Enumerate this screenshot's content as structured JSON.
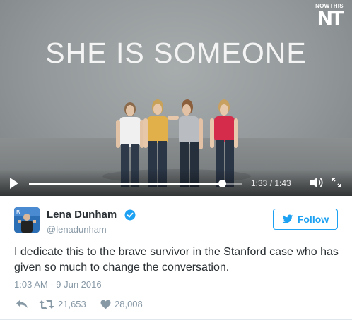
{
  "video": {
    "headline": "SHE IS SOMEONE",
    "brand": {
      "name": "NOWTHIS",
      "logo": "NT"
    },
    "player": {
      "current_time": "1:33",
      "duration": "1:43",
      "time_display": "1:33 / 1:43",
      "progress": 0.9029,
      "icons": [
        "play-icon",
        "volume-icon",
        "fullscreen-icon"
      ]
    }
  },
  "tweet": {
    "author": {
      "name": "Lena Dunham",
      "handle": "@lenadunham",
      "verified": true
    },
    "follow_label": "Follow",
    "text": "I dedicate this to the brave survivor in the Stanford case who has given so much to change the conversation.",
    "timestamp": "1:03 AM - 9 Jun 2016",
    "actions": {
      "reply_icon": "reply-icon",
      "retweets": "21,653",
      "likes": "28,008"
    }
  },
  "colors": {
    "accent": "#1da1f2",
    "muted": "#8899a6",
    "text": "#292f33"
  }
}
